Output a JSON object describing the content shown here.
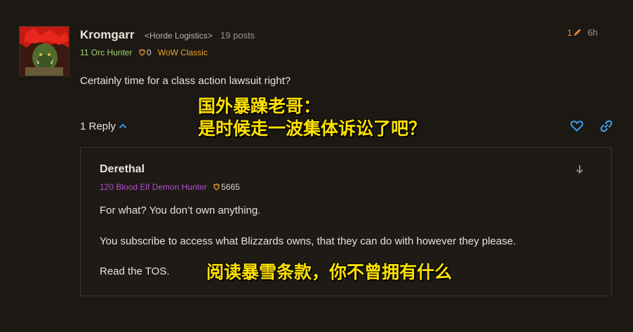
{
  "post": {
    "author": "Kromgarr",
    "guild": "<Horde Logistics>",
    "post_count": "19 posts",
    "character": "11 Orc Hunter",
    "achievement_points": "0",
    "game": "WoW Classic",
    "edit_count": "1",
    "time_ago": "6h",
    "body": "Certainly time for a class action lawsuit right?",
    "reply_count_label": "1 Reply",
    "icons": [
      "pencil-icon",
      "chevron-up-icon",
      "heart-icon",
      "link-icon"
    ]
  },
  "overlays": {
    "line1": "国外暴躁老哥：",
    "line2": "是时候走一波集体诉讼了吧？",
    "line3": "阅读暴雪条款，你不曾拥有什么"
  },
  "reply": {
    "author": "Derethal",
    "character": "120 Blood Elf Demon Hunter",
    "achievement_points": "5665",
    "p1": "For what? You don’t own anything.",
    "p2": "You subscribe to access what Blizzards owns, that they can do with however they please.",
    "p3": "Read the TOS.",
    "icons": [
      "arrow-down-icon",
      "shield-icon"
    ]
  },
  "colors": {
    "background": "#1c1814",
    "hunter_green": "#a5d66e",
    "classic_orange": "#f0a02a",
    "demon_hunter_purple": "#b34ecf",
    "accent_blue": "#3d9be9",
    "overlay_yellow": "#ffe100"
  }
}
